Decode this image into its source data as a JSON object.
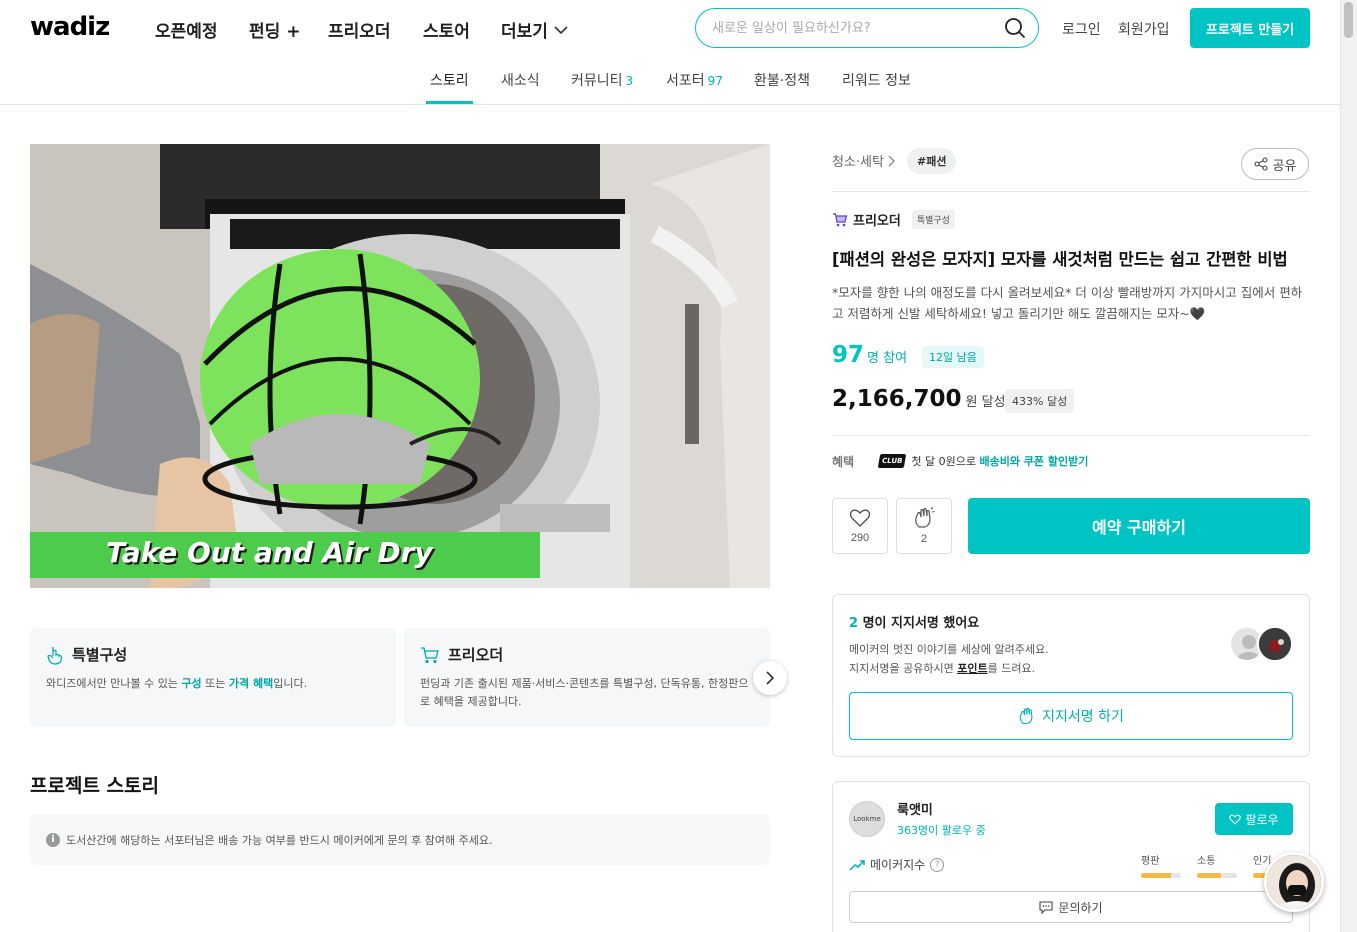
{
  "header": {
    "logo": "wadiz",
    "nav": [
      "오픈예정",
      "펀딩 +",
      "프리오더",
      "스토어",
      "더보기"
    ],
    "search_placeholder": "새로운 일상이 필요하신가요?",
    "login": "로그인",
    "signup": "회원가입",
    "make_project": "프로젝트 만들기"
  },
  "tabs": [
    {
      "label": "스토리",
      "count": ""
    },
    {
      "label": "새소식",
      "count": ""
    },
    {
      "label": "커뮤니티",
      "count": "3"
    },
    {
      "label": "서포터",
      "count": "97"
    },
    {
      "label": "환불·정책",
      "count": ""
    },
    {
      "label": "리워드 정보",
      "count": ""
    }
  ],
  "media": {
    "caption": "Take Out and Air Dry"
  },
  "cards": [
    {
      "title": "특별구성",
      "desc_pre": "와디즈에서만 만나볼 수 있는 ",
      "hl1": "구성",
      "mid": " 또는 ",
      "hl2": "가격 혜택",
      "desc_post": "입니다."
    },
    {
      "title": "프리오더",
      "desc": "펀딩과 기존 출시된 제품·서비스·콘텐츠를 특별구성, 단독유통, 한정판으로 혜택을 제공합니다."
    }
  ],
  "story": {
    "title": "프로젝트 스토리",
    "notice": "도서산간에 해당하는 서포터님은 배송 가능 여부를 반드시 메이커에게 문의 후 참여해 주세요."
  },
  "product": {
    "category": "청소·세탁",
    "tag": "#패션",
    "share": "공유",
    "type": "프리오더",
    "type_badge": "특별구성",
    "title": "[패션의 완성은 모자지] 모자를 새것처럼 만드는 쉽고 간편한 비법",
    "desc": "*모자를 향한 나의 애정도를 다시 올려보세요* 더 이상 빨래방까지 가지마시고 집에서 편하고 저렴하게 신발 세탁하세요! 넣고 돌리기만 해도 깔끔해지는 모자~🖤",
    "participants": "97",
    "participants_unit": "명 참여",
    "days_left": "12일 남음",
    "amount": "2,166,700",
    "amount_unit": "원 달성",
    "achieved": "433% 달성",
    "benefit_label": "혜택",
    "club": "CLUB",
    "benefit_text": "첫 달 0원으로 ",
    "benefit_hl": "배송비와 쿠폰 할인받기",
    "likes": "290",
    "cheers": "2",
    "buy": "예약 구매하기"
  },
  "signature": {
    "count": "2",
    "title_rest": " 명이 지지서명 했어요",
    "desc1": "메이커의 멋진 이야기를 세상에 알려주세요.",
    "desc2_pre": "지지서명을 공유하시면 ",
    "desc2_hl": "포인트",
    "desc2_post": "를 드려요.",
    "button": "지지서명 하기"
  },
  "maker": {
    "avatar_text": "Lookme",
    "name": "룩앳미",
    "followers": "363명이 팔로우 중",
    "follow": "팔로우",
    "index_label": "메이커지수",
    "bars": [
      {
        "label": "평판",
        "level": 0.75
      },
      {
        "label": "소통",
        "level": 0.6
      },
      {
        "label": "인기",
        "level": 0.5
      }
    ],
    "inquiry": "문의하기"
  },
  "colors": {
    "accent": "#00c4c4",
    "caption_bg": "#4ccb4c",
    "star": "#f5b947"
  }
}
